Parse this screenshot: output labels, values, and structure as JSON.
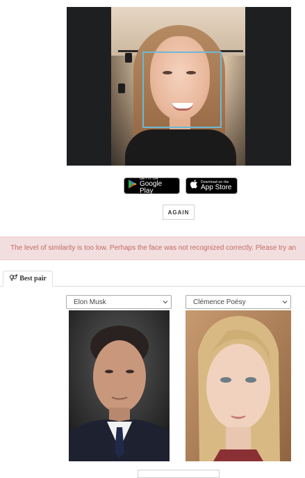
{
  "badges": {
    "google_play": {
      "small": "GET IT ON",
      "big": "Google Play"
    },
    "app_store": {
      "small": "Download on the",
      "big": "App Store"
    }
  },
  "again_button": "AGAIN",
  "alert": {
    "text": "The level of similarity is too low. Perhaps the face was not recognized correctly. Please try an",
    "color": "#c26a68"
  },
  "tabs": [
    {
      "label": "Best pair",
      "icon": "gender-icon",
      "active": true
    }
  ],
  "pair": {
    "left": {
      "selected": "Elon Musk"
    },
    "right": {
      "selected": "Clémence Poésy"
    }
  },
  "colors": {
    "face_box": "#6cb9d6",
    "alert_bg": "#f2dede"
  }
}
